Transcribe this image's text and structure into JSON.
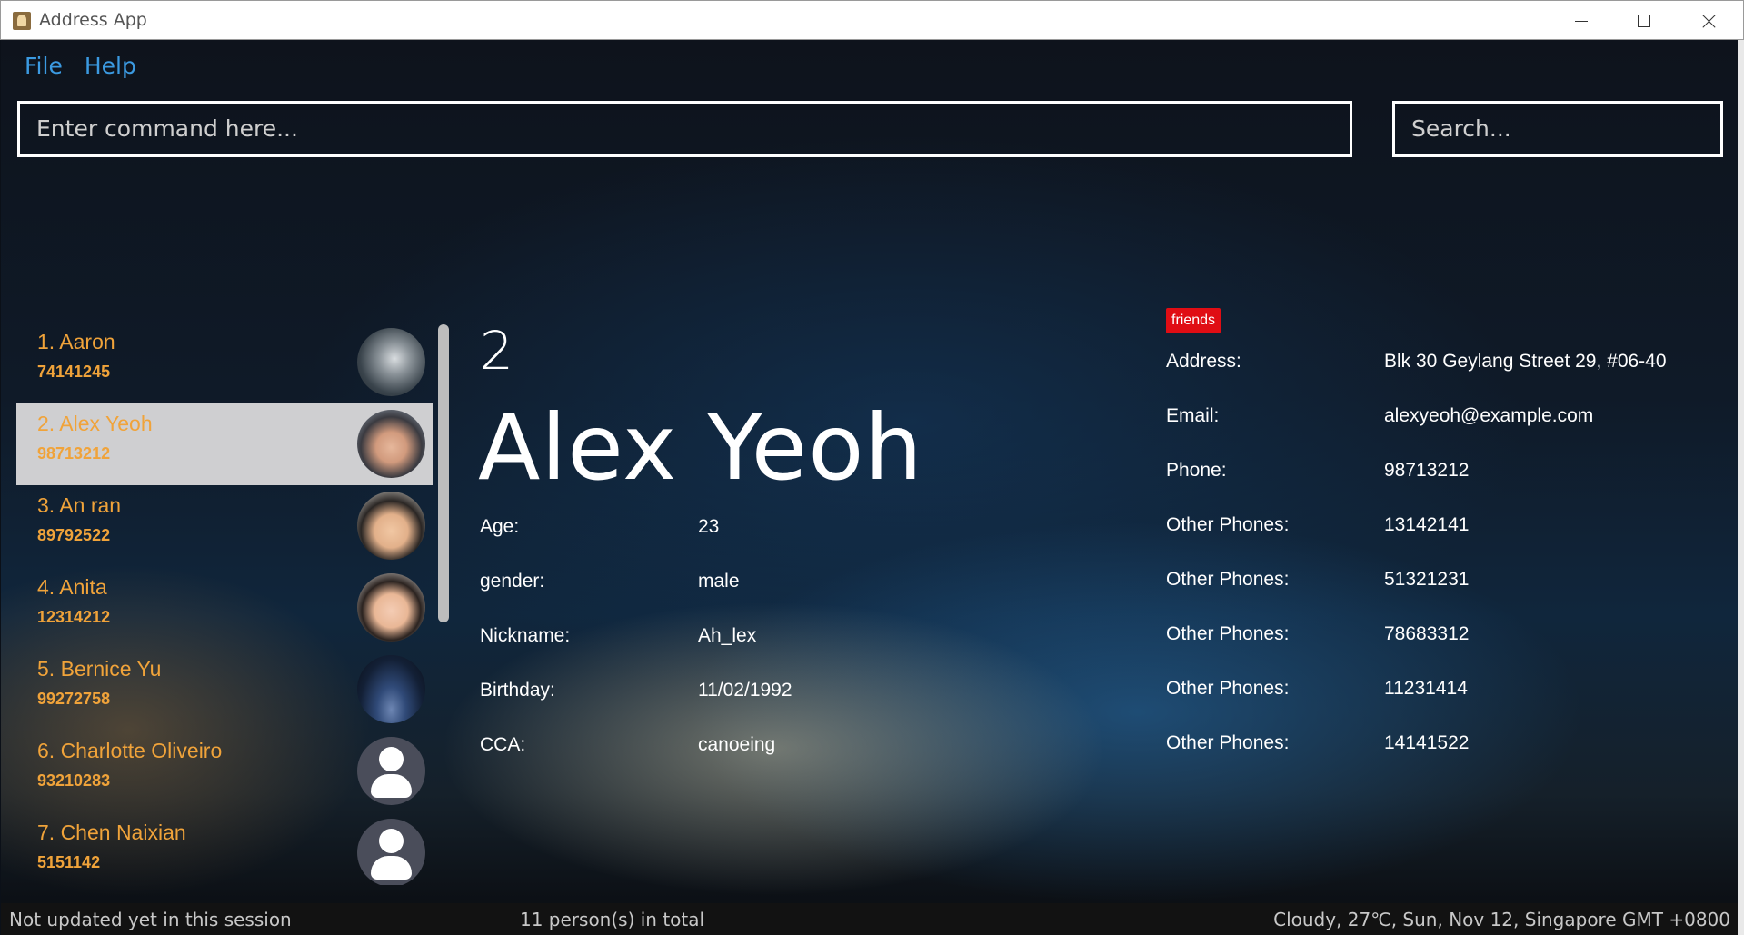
{
  "window": {
    "title": "Address App"
  },
  "menu": {
    "file": "File",
    "help": "Help"
  },
  "command": {
    "placeholder": "Enter command here..."
  },
  "search": {
    "placeholder": "Search..."
  },
  "persons": [
    {
      "label": "1.  Aaron",
      "phone": "74141245"
    },
    {
      "label": "2.  Alex Yeoh",
      "phone": "98713212"
    },
    {
      "label": "3.  An ran",
      "phone": "89792522"
    },
    {
      "label": "4.  Anita",
      "phone": "12314212"
    },
    {
      "label": "5.  Bernice Yu",
      "phone": "99272758"
    },
    {
      "label": "6.  Charlotte Oliveiro",
      "phone": "93210283"
    },
    {
      "label": "7.  Chen Naixian",
      "phone": "5151142"
    }
  ],
  "detail": {
    "index": "2",
    "name": "Alex Yeoh",
    "tag": "friends",
    "left_fields": [
      {
        "label": "Age:",
        "value": "23"
      },
      {
        "label": "gender:",
        "value": "male"
      },
      {
        "label": "Nickname:",
        "value": "Ah_lex"
      },
      {
        "label": "Birthday:",
        "value": "11/02/1992"
      },
      {
        "label": "CCA:",
        "value": "canoeing"
      }
    ],
    "right_fields": [
      {
        "label": "Address:",
        "value": "Blk 30 Geylang Street 29, #06-40"
      },
      {
        "label": "Email:",
        "value": "alexyeoh@example.com"
      },
      {
        "label": "Phone:",
        "value": "98713212"
      },
      {
        "label": "Other Phones:",
        "value": "13142141"
      },
      {
        "label": "Other Phones:",
        "value": "51321231"
      },
      {
        "label": "Other Phones:",
        "value": "78683312"
      },
      {
        "label": "Other Phones:",
        "value": "11231414"
      },
      {
        "label": "Other Phones:",
        "value": "14141522"
      }
    ]
  },
  "status": {
    "sync": "Not updated yet in this session",
    "count": "11 person(s) in total",
    "weather": "Cloudy, 27℃, Sun, Nov 12, Singapore GMT +0800"
  },
  "colors": {
    "accent_orange": "#f0a33a",
    "menu_blue": "#3b9ae1",
    "tag_red": "#e00d14",
    "selected_bg": "#cfcfd1"
  },
  "icons": [
    "app-icon",
    "minimize-icon",
    "maximize-icon",
    "close-icon",
    "avatar-default-icon"
  ]
}
